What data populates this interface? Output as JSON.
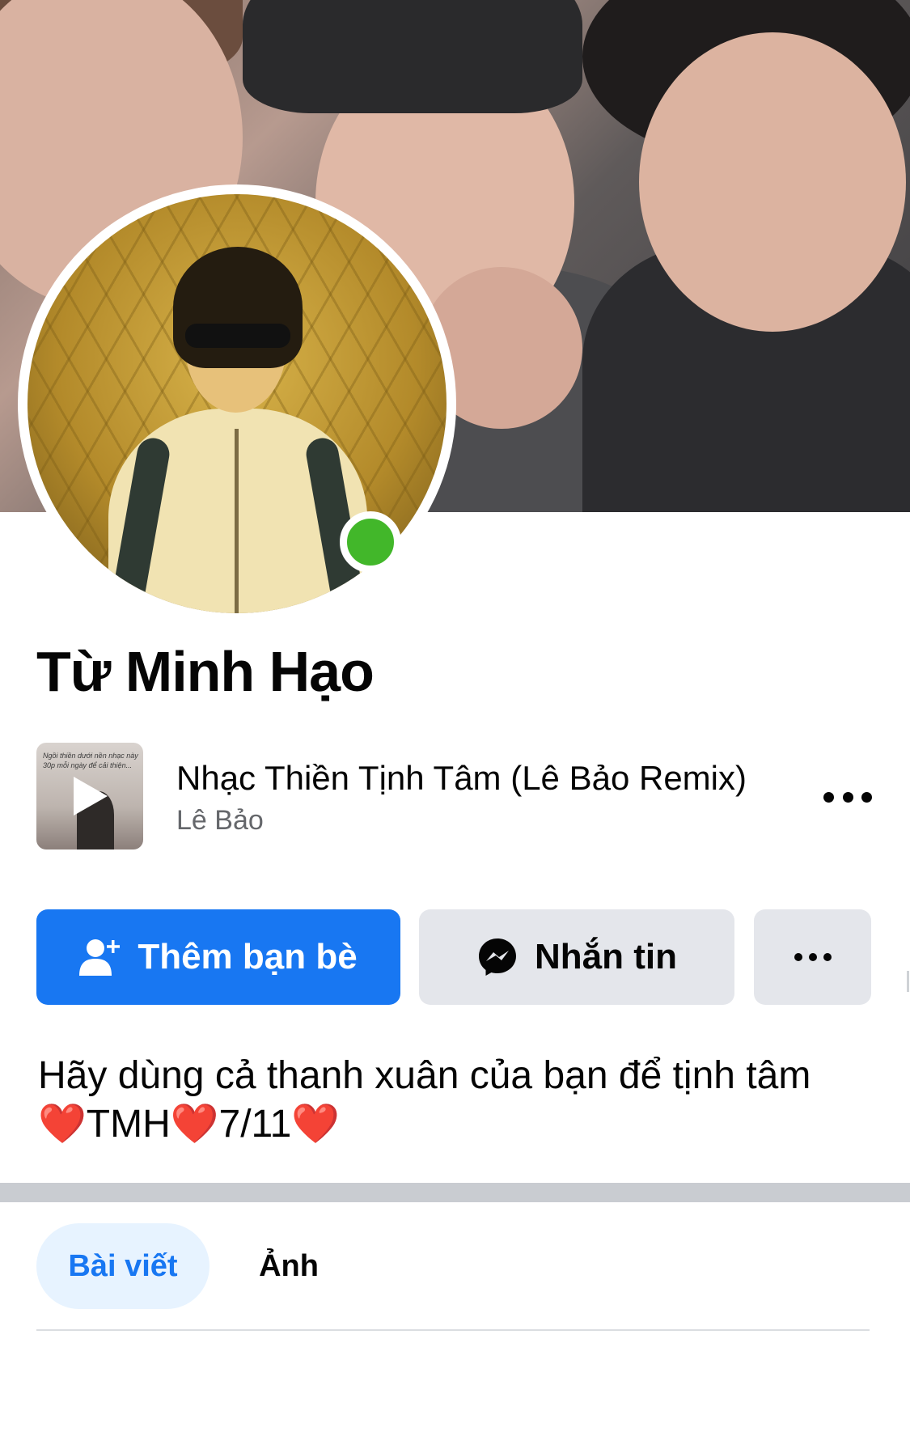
{
  "profile": {
    "name": "Từ Minh Hạo",
    "online": true,
    "status_color": "#42B72A"
  },
  "music": {
    "title": "Nhạc Thiền Tịnh Tâm (Lê Bảo Remix)",
    "artist": "Lê Bảo",
    "thumbnail_text": "Ngồi thiền dưới nền nhạc này 30p mỗi ngày để cải thiện...",
    "play_icon": "play-icon",
    "more_icon": "more-horizontal-icon"
  },
  "actions": {
    "add_friend_label": "Thêm bạn bè",
    "add_friend_icon": "add-friend-icon",
    "message_label": "Nhắn tin",
    "message_icon": "messenger-icon",
    "more_icon": "more-horizontal-icon"
  },
  "bio": {
    "line1": "Hãy dùng cả thanh xuân của bạn để tịnh tâm",
    "heart": "❤️",
    "initials": "TMH",
    "date": "7/11"
  },
  "tabs": [
    {
      "label": "Bài viết",
      "active": true
    },
    {
      "label": "Ảnh",
      "active": false
    }
  ],
  "colors": {
    "primary_blue": "#1877F2",
    "secondary_button": "#E4E6EB",
    "active_tab_bg": "#E7F3FF",
    "secondary_text": "#65676B"
  }
}
